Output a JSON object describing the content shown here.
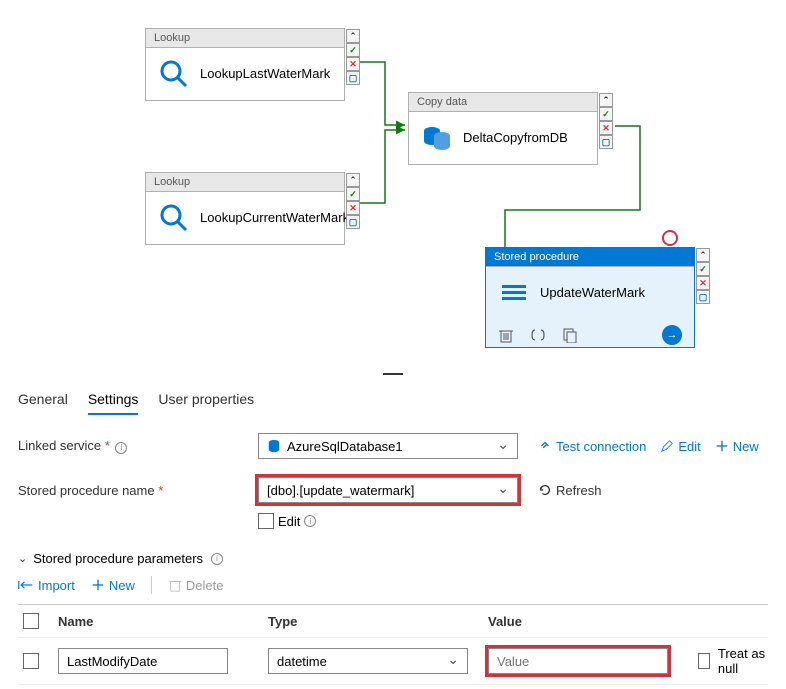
{
  "activities": {
    "lookup1": {
      "type": "Lookup",
      "name": "LookupLastWaterMark"
    },
    "lookup2": {
      "type": "Lookup",
      "name": "LookupCurrentWaterMark"
    },
    "copy": {
      "type": "Copy data",
      "name": "DeltaCopyfromDB"
    },
    "sproc": {
      "type": "Stored procedure",
      "name": "UpdateWaterMark"
    }
  },
  "tabs": {
    "general": "General",
    "settings": "Settings",
    "user_properties": "User properties"
  },
  "form": {
    "linked_service_label": "Linked service",
    "linked_service_value": "AzureSqlDatabase1",
    "test_connection": "Test connection",
    "edit": "Edit",
    "new": "New",
    "sproc_label": "Stored procedure name",
    "sproc_value": "[dbo].[update_watermark]",
    "refresh": "Refresh",
    "edit_checkbox": "Edit",
    "params_header": "Stored procedure parameters",
    "import": "Import",
    "delete": "Delete"
  },
  "table": {
    "headers": {
      "name": "Name",
      "type": "Type",
      "value": "Value"
    },
    "rows": [
      {
        "name": "LastModifyDate",
        "type": "datetime",
        "value_placeholder": "Value",
        "treat_as_null": "Treat as null"
      }
    ]
  }
}
